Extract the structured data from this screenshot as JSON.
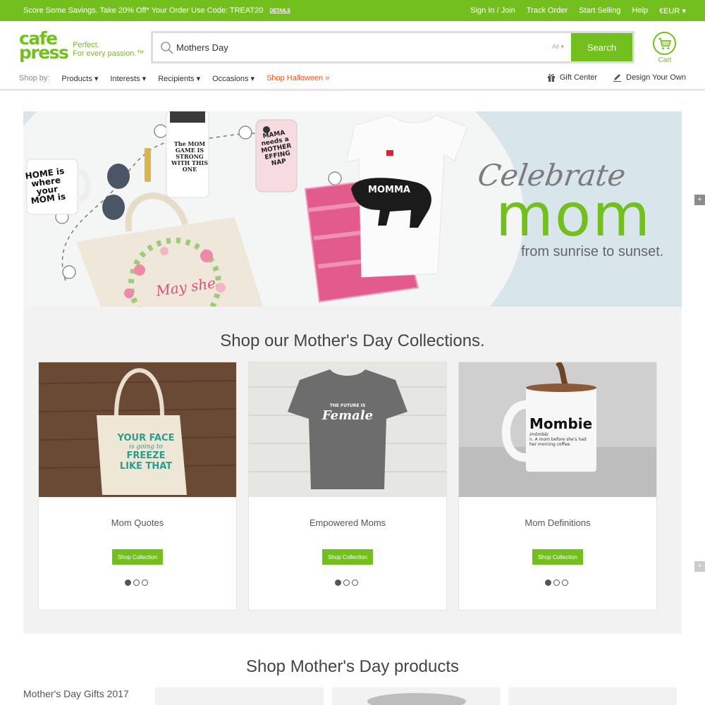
{
  "promo": {
    "text": "Score Some Savings. Take 20% Off* Your Order Use Code: TREAT20",
    "details": "DETAILS",
    "links": [
      "Sign In / Join",
      "Track Order",
      "Start Selling",
      "Help",
      "€EUR ▾"
    ]
  },
  "logo": {
    "word_top": "cafe",
    "word_bottom": "press",
    "tagline_1": "Perfect.",
    "tagline_2": "For every passion.™"
  },
  "search": {
    "value": "Mothers Day",
    "category": "All ▾",
    "button": "Search"
  },
  "cart": {
    "label": "Cart"
  },
  "nav": {
    "shop_by": "Shop by:",
    "items": [
      "Products ▾",
      "Interests ▾",
      "Recipients ▾",
      "Occasions ▾",
      "Shop Halloween »"
    ],
    "gift_center": "Gift Center",
    "design_your_own": "Design Your Own"
  },
  "hero": {
    "script": "Celebrate",
    "big": "mom",
    "sub": "from sunrise to sunset.",
    "mug_text": "HOME is where your MOM is",
    "bottle_text": "The MOM GAME IS STRONG WITH THIS ONE",
    "phone_text": "MAMA needs a MOTHER EFFING NAP",
    "shirt_text": "MOMMA",
    "tote_text": "May she"
  },
  "collections": {
    "title": "Shop our Mother's Day Collections.",
    "cards": [
      {
        "title": "Mom Quotes",
        "button": "Shop Collection",
        "img_text": [
          "YOUR FACE",
          "is going to",
          "FREEZE",
          "LIKE THAT"
        ]
      },
      {
        "title": "Empowered Moms",
        "button": "Shop Collection",
        "img_text": [
          "THE FUTURE IS",
          "Female"
        ]
      },
      {
        "title": "Mom Definitions",
        "button": "Shop Collection",
        "img_text": [
          "Mombie",
          "/mŏmbē/",
          "n. A mom before she's had",
          "her morning coffee."
        ]
      }
    ]
  },
  "products": {
    "title": "Shop Mother's Day products",
    "sidebar_item": "Mother's Day Gifts 2017"
  },
  "colors": {
    "brand": "#73bf1e",
    "accent": "#e8541c"
  }
}
